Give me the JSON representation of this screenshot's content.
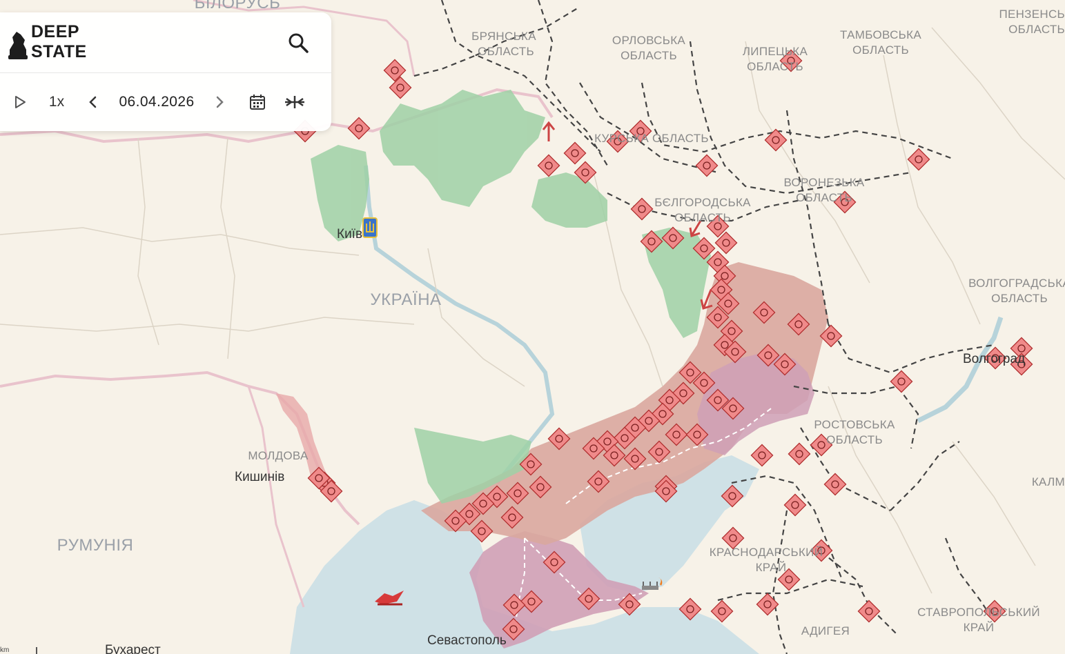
{
  "app": {
    "logo_line1": "DEEP",
    "logo_line2": "STATE"
  },
  "toolbar": {
    "speed": "1x",
    "date": "06.04.2026"
  },
  "labels": {
    "belarus": "БІЛОРУСЬ",
    "bryansk_1": "БРЯНСЬКА",
    "bryansk_2": "ОБЛАСТЬ",
    "oryol_1": "ОРЛОВСЬКА",
    "oryol_2": "ОБЛАСТЬ",
    "lipetsk_1": "ЛИПЕЦЬКА",
    "lipetsk_2": "ОБЛАСТЬ",
    "tambov_1": "ТАМБОВСЬКА",
    "tambov_2": "ОБЛАСТЬ",
    "penza_1": "ПЕНЗЕНСЬ",
    "penza_2": "ОБЛАСТЬ",
    "kursk": "КУРСЬКА ОБЛАСТЬ",
    "voronezh_1": "ВОРОНЕЗЬКА",
    "voronezh_2": "ОБЛАСТЬ",
    "belgorod_1": "БЄЛГОРОДСЬКА",
    "belgorod_2": "ОБЛАСТЬ",
    "kyiv": "Київ",
    "ukraine": "УКРАЇНА",
    "volgograd_1": "ВОЛГОГРАДСЬКА",
    "volgograd_2": "ОБЛАСТЬ",
    "volgograd_city": "Волгоград",
    "moldova": "МОЛДОВА",
    "chisinau": "Кишинів",
    "rostov_1": "РОСТОВСЬКА",
    "rostov_2": "ОБЛАСТЬ",
    "kalm": "КАЛМ",
    "romania": "РУМУНІЯ",
    "krasnodar_1": "КРАСНОДАРСЬКИЙ",
    "krasnodar_2": "КРАЙ",
    "stavropol_1": "СТАВРОПОЛЬСЬКИЙ",
    "stavropol_2": "КРАЙ",
    "adygea": "АДИГЕЯ",
    "sevastopol": "Севастополь",
    "bucharest": "Бухарест",
    "scale": "km"
  },
  "colors": {
    "land": "#f7f2e8",
    "sea": "#cfe1e6",
    "occupied": "#d9a79e",
    "occupied_pre2022": "#cfa0b6",
    "liberated": "#9fd1a6",
    "attack_marker": "#f08a8a",
    "marker_border": "#b03030"
  },
  "icons": {
    "search": "search-icon",
    "play": "play-icon",
    "prev": "chevron-left-icon",
    "next": "chevron-right-icon",
    "calendar": "calendar-icon",
    "collapse": "collapse-icon"
  }
}
